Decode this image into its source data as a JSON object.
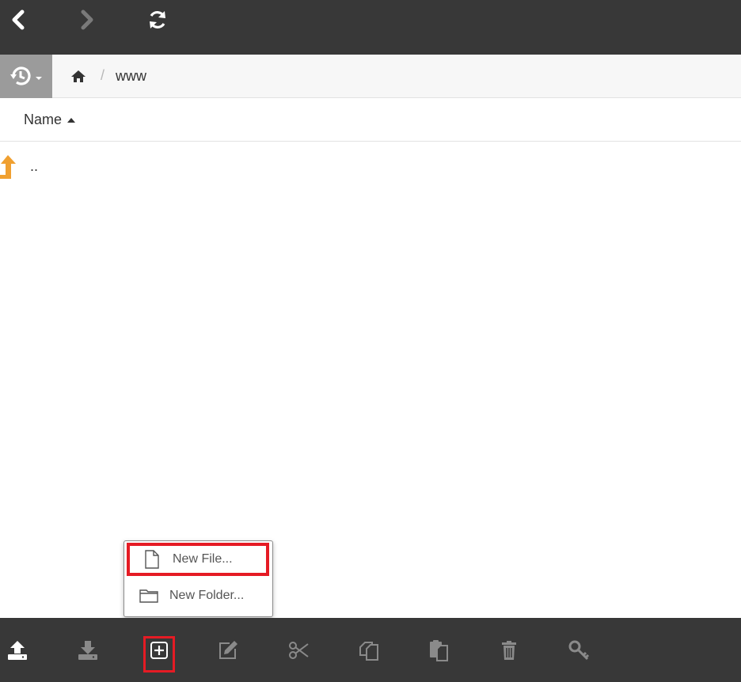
{
  "breadcrumb": {
    "separator": "/",
    "current": "www"
  },
  "columns": {
    "name_label": "Name",
    "sort": "ascending"
  },
  "files": [
    {
      "name": ".."
    }
  ],
  "context_menu": {
    "items": [
      {
        "label": "New File...",
        "icon": "file-icon",
        "highlighted": true
      },
      {
        "label": "New Folder...",
        "icon": "folder-icon",
        "highlighted": false
      }
    ]
  },
  "toolbar": {
    "icons": [
      "upload-icon",
      "download-icon",
      "new-icon",
      "edit-icon",
      "cut-icon",
      "copy-icon",
      "paste-icon",
      "delete-icon",
      "permissions-icon"
    ],
    "highlighted": "new-icon"
  },
  "colors": {
    "bar_background": "#383838",
    "highlight": "#e51b24",
    "parent_arrow": "#f0a030",
    "history_button": "#9b9b9b"
  }
}
